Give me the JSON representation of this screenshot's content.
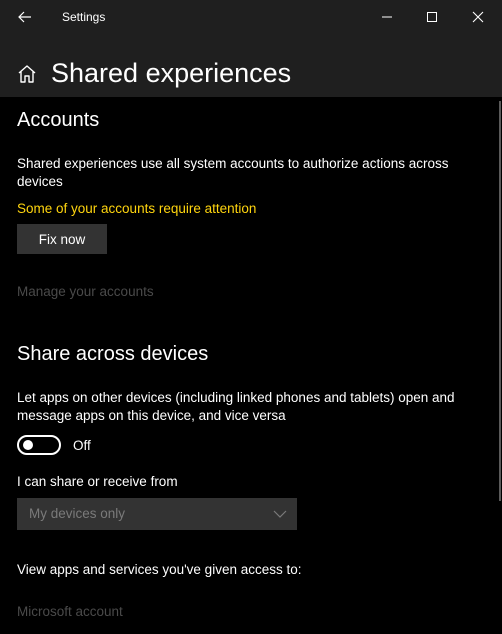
{
  "window": {
    "app_title": "Settings",
    "controls": [
      "minimize-icon",
      "maximize-icon",
      "close-icon"
    ]
  },
  "header": {
    "icon": "home-icon",
    "title": "Shared experiences"
  },
  "accounts": {
    "title": "Accounts",
    "description": "Shared experiences use all system accounts to authorize actions across devices",
    "warning": "Some of your accounts require attention",
    "fix_button": "Fix now",
    "manage_link": "Manage your accounts"
  },
  "share": {
    "title": "Share across devices",
    "description": "Let apps on other devices (including linked phones and tablets) open and message apps on this device, and vice versa",
    "toggle_state": "Off",
    "share_from_label": "I can share or receive from",
    "share_from_value": "My devices only",
    "access_label": "View apps and services you've given access to:",
    "microsoft_account_link": "Microsoft account"
  },
  "colors": {
    "background": "#000000",
    "titlebar": "#1f1f1f",
    "warning": "#ffd50e",
    "disabled_text": "#4a4a4a",
    "button_bg": "#333333"
  }
}
